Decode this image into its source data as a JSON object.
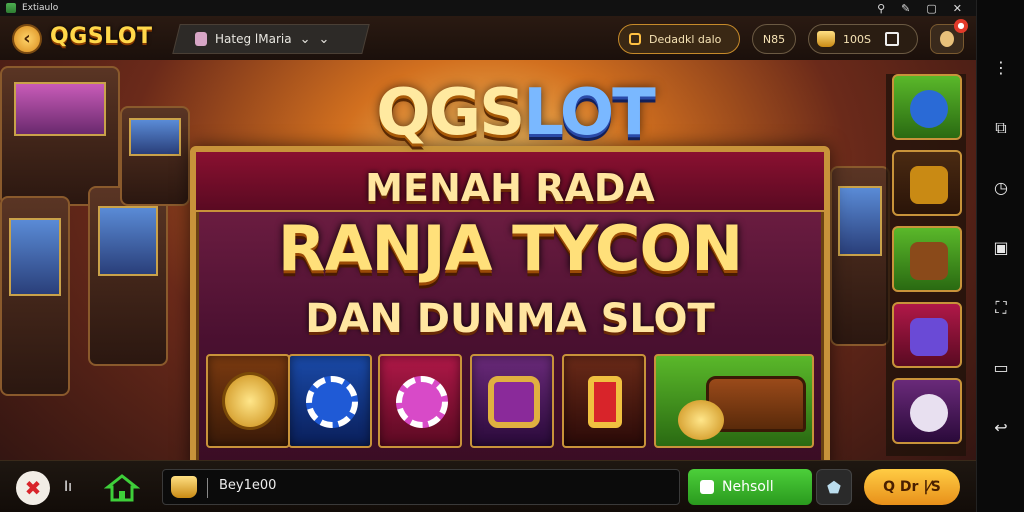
{
  "window": {
    "app_name": "Extiaulo",
    "controls": [
      "⚲",
      "✎",
      "▢",
      "✕"
    ]
  },
  "topbar": {
    "back_icon": "back-arrow-icon",
    "logo": "QGSLOT",
    "room_label": "Hateg lMaria",
    "daily_label": "Dedadkl dalo",
    "count": "N85",
    "coins": "100S"
  },
  "banner": {
    "title_a": "QGS",
    "title_b": "LOT",
    "line1": "MENAH RADA",
    "line2": "RANJA TYCON",
    "line3": "DAN DUNMA SLOT"
  },
  "bottombar": {
    "close_glyph": "✖",
    "in_label": "Iı",
    "search_value": "Bey1e00",
    "green_button": "Nehsoll",
    "gold_button": "Q Dr |⁄S"
  },
  "emulator_tools": [
    "⋮",
    "⧉",
    "◷",
    "▣",
    "⛶",
    "▭",
    "↩"
  ],
  "colors": {
    "accent_gold": "#c8933a",
    "logo_yellow": "#ffd84a",
    "green": "#2a9a1e"
  }
}
